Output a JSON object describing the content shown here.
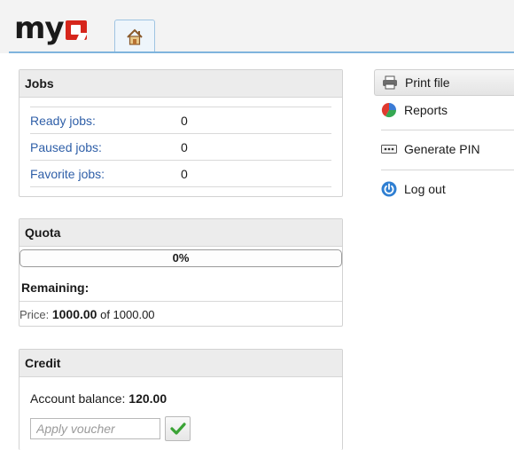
{
  "header": {
    "logo_text": "my",
    "home_tab_icon": "home-icon"
  },
  "jobs": {
    "title": "Jobs",
    "rows": [
      {
        "label": "Ready jobs:",
        "value": "0"
      },
      {
        "label": "Paused jobs:",
        "value": "0"
      },
      {
        "label": "Favorite jobs:",
        "value": "0"
      }
    ]
  },
  "quota": {
    "title": "Quota",
    "progress_fraction": 0,
    "progress_text": "0%",
    "remaining_label": "Remaining:",
    "price_label": "Price:",
    "price_value": "1000.00",
    "price_of": "of 1000.00"
  },
  "credit": {
    "title": "Credit",
    "balance_label": "Account balance:",
    "balance_value": "120.00",
    "voucher_placeholder": "Apply voucher"
  },
  "menu": {
    "items": [
      {
        "label": "Print file",
        "icon": "printer-icon"
      },
      {
        "label": "Reports",
        "icon": "pie-chart-icon"
      },
      {
        "label": "Generate PIN",
        "icon": "pin-icon"
      },
      {
        "label": "Log out",
        "icon": "power-icon"
      }
    ]
  },
  "colors": {
    "link": "#2f5fa8",
    "brand_red": "#d6261c",
    "accent": "#7fb4dd",
    "check_green": "#3aa335"
  }
}
